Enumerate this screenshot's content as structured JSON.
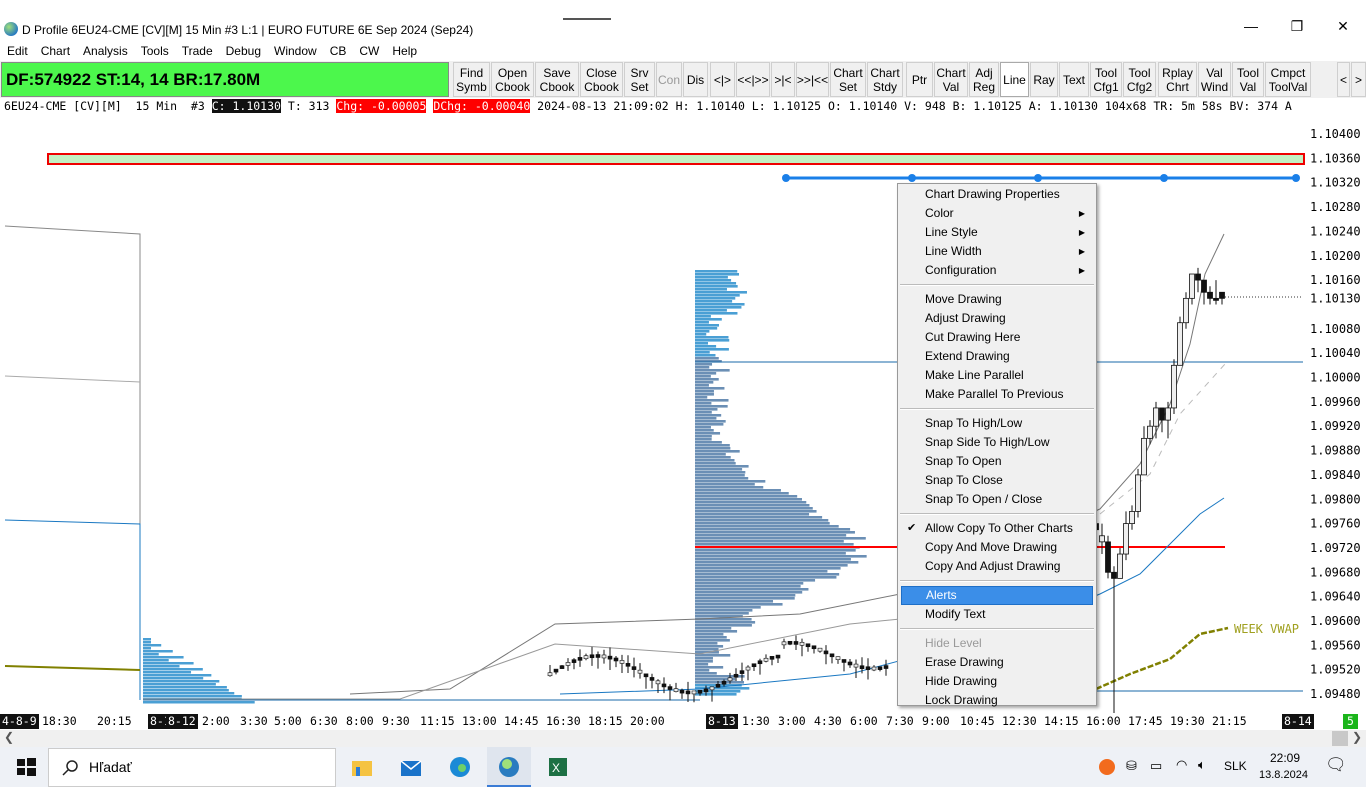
{
  "window": {
    "title": "D Profile 6EU24-CME [CV][M]  15 Min  #3 L:1 | EURO FUTURE 6E Sep 2024 (Sep24)",
    "minimize": "—",
    "maximize": "❐",
    "close": "✕"
  },
  "menubar": [
    "Edit",
    "Chart",
    "Analysis",
    "Tools",
    "Trade",
    "Debug",
    "Window",
    "CB",
    "CW",
    "Help"
  ],
  "status_panel": "DF:574922  ST:14, 14  BR:17.80M",
  "toolbar": [
    {
      "label": "Find\nSymb"
    },
    {
      "label": "Open\nCbook"
    },
    {
      "label": "Save\nCbook"
    },
    {
      "label": "Close\nCbook"
    },
    {
      "label": "Srv\nSet"
    },
    {
      "label": "Con",
      "disabled": true
    },
    {
      "label": "Dis"
    },
    {
      "label": "<|>"
    },
    {
      "label": "<<|>>"
    },
    {
      "label": ">|<"
    },
    {
      "label": ">>|<<"
    },
    {
      "label": "Chart\nSet"
    },
    {
      "label": "Chart\nStdy"
    },
    {
      "label": "Ptr"
    },
    {
      "label": "Chart\nVal"
    },
    {
      "label": "Adj\nReg"
    },
    {
      "label": "Line",
      "pressed": true
    },
    {
      "label": "Ray"
    },
    {
      "label": "Text"
    },
    {
      "label": "Tool\nCfg1"
    },
    {
      "label": "Tool\nCfg2"
    },
    {
      "label": "Rplay\nChrt"
    },
    {
      "label": "Val\nWind"
    },
    {
      "label": "Tool\nVal"
    },
    {
      "label": "Cmpct\nToolVal"
    },
    {
      "label": "<"
    },
    {
      "label": ">"
    }
  ],
  "info": {
    "symbol": "6EU24-CME [CV][M]  15 Min  #3 ",
    "close": "C: 1.10130",
    "trades": " T: 313 ",
    "chg": "Chg: -0.00005",
    "sp": " ",
    "dchg": "DChg: -0.00040",
    "rest": " 2024-08-13 21:09:02 H: 1.10140 L: 1.10125 O: 1.10140 V: 948 B: 1.10125 A: 1.10130 104x68 TR: 5m 58s BV: 374 A"
  },
  "price_axis": [
    "1.10400",
    "1.10360",
    "1.10320",
    "1.10280",
    "1.10240",
    "1.10200",
    "1.10160",
    "1.10130",
    "1.10080",
    "1.10040",
    "1.10000",
    "1.09960",
    "1.09920",
    "1.09880",
    "1.09840",
    "1.09800",
    "1.09760",
    "1.09720",
    "1.09680",
    "1.09640",
    "1.09600",
    "1.09560",
    "1.09520",
    "1.09480"
  ],
  "week_vwap_label": "WEEK VWAP",
  "time_axis": [
    {
      "t": "4-8-9",
      "d": true
    },
    {
      "t": "18:30"
    },
    {
      "t": "20:15"
    },
    {
      "t": "8-11",
      "d": true
    },
    {
      "t": "8-12",
      "d": true
    },
    {
      "t": "2:00"
    },
    {
      "t": "3:30"
    },
    {
      "t": "5:00"
    },
    {
      "t": "6:30"
    },
    {
      "t": "8:00"
    },
    {
      "t": "9:30"
    },
    {
      "t": "11:15"
    },
    {
      "t": "13:00"
    },
    {
      "t": "14:45"
    },
    {
      "t": "16:30"
    },
    {
      "t": "18:15"
    },
    {
      "t": "20:00"
    },
    {
      "t": "8-13",
      "d": true
    },
    {
      "t": "1:30"
    },
    {
      "t": "3:00"
    },
    {
      "t": "4:30"
    },
    {
      "t": "6:00"
    },
    {
      "t": "7:30"
    },
    {
      "t": "9:00"
    },
    {
      "t": "10:45"
    },
    {
      "t": "12:30"
    },
    {
      "t": "14:15"
    },
    {
      "t": "16:00"
    },
    {
      "t": "17:45"
    },
    {
      "t": "19:30"
    },
    {
      "t": "21:15"
    },
    {
      "t": "8-14",
      "d": true
    },
    {
      "t": "5",
      "g": true
    }
  ],
  "context_menu": [
    {
      "label": "Chart Drawing Properties"
    },
    {
      "label": "Color",
      "sub": true
    },
    {
      "label": "Line Style",
      "sub": true
    },
    {
      "label": "Line Width",
      "sub": true
    },
    {
      "label": "Configuration",
      "sub": true
    },
    {
      "sep": true
    },
    {
      "label": "Move Drawing"
    },
    {
      "label": "Adjust Drawing"
    },
    {
      "label": "Cut Drawing Here"
    },
    {
      "label": "Extend Drawing"
    },
    {
      "label": "Make Line Parallel"
    },
    {
      "label": "Make Parallel To Previous"
    },
    {
      "sep": true
    },
    {
      "label": "Snap To High/Low"
    },
    {
      "label": "Snap Side To High/Low"
    },
    {
      "label": "Snap To Open"
    },
    {
      "label": "Snap To Close"
    },
    {
      "label": "Snap To Open / Close"
    },
    {
      "sep": true
    },
    {
      "label": "Allow Copy To Other Charts",
      "checked": true
    },
    {
      "label": "Copy And Move Drawing"
    },
    {
      "label": "Copy And Adjust Drawing"
    },
    {
      "sep": true
    },
    {
      "label": "Alerts",
      "highlighted": true
    },
    {
      "label": "Modify Text"
    },
    {
      "sep": true
    },
    {
      "label": "Hide Level",
      "disabled": true
    },
    {
      "label": "Erase Drawing"
    },
    {
      "label": "Hide Drawing"
    },
    {
      "label": "Lock Drawing"
    }
  ],
  "taskbar": {
    "search": "Hľadať",
    "lang": "SLK",
    "time": "22:09",
    "date": "13.8.2024"
  },
  "colors": {
    "status_green": "#4cf74c",
    "accent": "#3b8ee8",
    "profile": "#4a9fd4",
    "poc": "#ff0000",
    "vwap": "#808000"
  }
}
